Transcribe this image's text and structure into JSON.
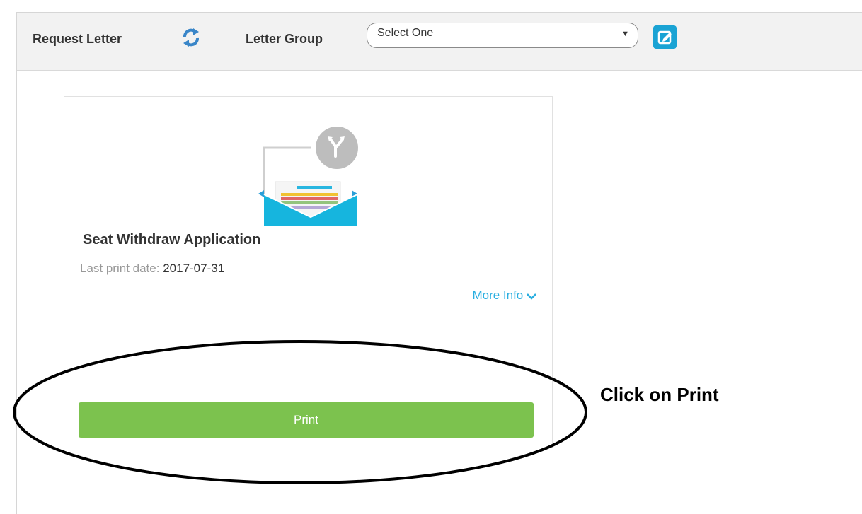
{
  "toolbar": {
    "request_letter_label": "Request Letter",
    "letter_group_label": "Letter Group",
    "letter_group_select": {
      "selected": "Select One"
    }
  },
  "card": {
    "title": "Seat Withdraw Application",
    "last_print_label": "Last print date:",
    "last_print_value": "2017-07-31",
    "more_info": "More Info",
    "print_button": "Print"
  },
  "annotation": {
    "text": "Click on Print"
  },
  "colors": {
    "accent_blue": "#1aa3d4",
    "link_blue": "#29aee0",
    "print_green": "#7cc24e",
    "toolbar_bg": "#f2f2f2"
  },
  "icons": [
    "refresh-icon",
    "chevron-down-icon",
    "edit-icon",
    "letter-envelope-icon",
    "select-caret-icon"
  ]
}
